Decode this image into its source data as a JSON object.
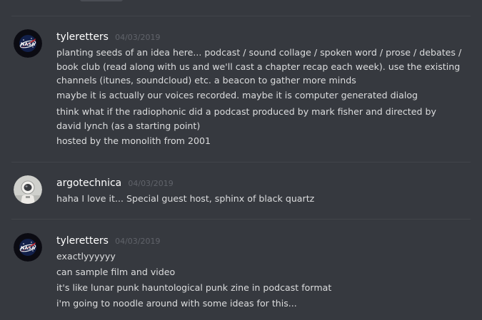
{
  "colors": {
    "background": "#36393f",
    "divider": "#42454a",
    "username": "#ffffff",
    "timestamp": "#60636a",
    "message_text": "#dcddde"
  },
  "groups": [
    {
      "username": "tyleretters",
      "timestamp": "04/03/2019",
      "avatar_icon": "nasa-logo-icon",
      "messages": [
        "planting seeds of an idea here... podcast / sound collage / spoken word / prose / debates / book club (read along with us and we'll cast a chapter recap each week). use the existing channels (itunes, soundcloud) etc. a beacon to gather more minds",
        "maybe it is actually our voices recorded. maybe it is computer generated dialog",
        "think what if the radiophonic did a podcast produced by mark fisher and directed by david lynch (as a starting point)",
        "hosted by the monolith from 2001"
      ]
    },
    {
      "username": "argotechnica",
      "timestamp": "04/03/2019",
      "avatar_icon": "astronaut-avatar-icon",
      "messages": [
        "haha I love it... Special guest host, sphinx of black quartz"
      ]
    },
    {
      "username": "tyleretters",
      "timestamp": "04/03/2019",
      "avatar_icon": "nasa-logo-icon",
      "messages": [
        "exactlyyyyyy",
        "can sample film and video",
        "it's like lunar punk hauntological punk zine in podcast format",
        "i'm going to noodle around with some ideas for this..."
      ]
    }
  ]
}
